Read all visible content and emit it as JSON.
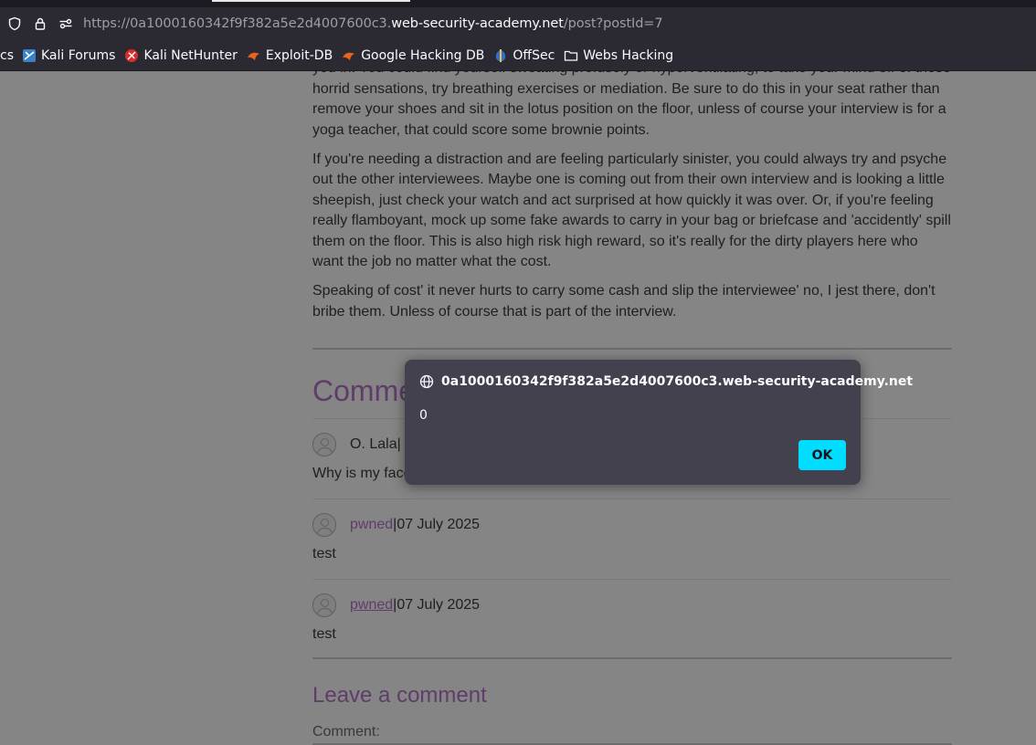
{
  "browser": {
    "url_prefix": "https://0a1000160342f9f382a5e2d4007600c3.",
    "url_domain": "web-security-academy.net",
    "url_path": "/post?postId=7",
    "bookmarks": [
      {
        "label": "cs",
        "icon": "none"
      },
      {
        "label": "Kali Forums",
        "icon": "kali-forums-icon"
      },
      {
        "label": "Kali NetHunter",
        "icon": "kali-nethunter-icon"
      },
      {
        "label": "Exploit-DB",
        "icon": "exploit-db-icon"
      },
      {
        "label": "Google Hacking DB",
        "icon": "ghdb-icon"
      },
      {
        "label": "OffSec",
        "icon": "offsec-icon"
      },
      {
        "label": "Webs Hacking",
        "icon": "folder-icon"
      }
    ]
  },
  "article": {
    "paragraphs": [
      "you in. You could find yourself sweating profusely or hyperventilating, to take your mind off of these horrid sensations, try breathing exercises or mediation. Be sure to do this in your seat rather than remove your shoes and sit in the lotus position on the floor, unless of course your interview is for a yoga teacher, that could score some brownie points.",
      "If you're needing a distraction and are feeling particularly sinister, you could always try and psyche out the other interviewees. Maybe one is coming out from their own interview and is looking a little sheepish, just check your watch and act surprised at how quickly it was over. Or, if you're feeling really flamboyant, mock up some fake awards to carry in your bag or briefcase and 'accidently' spill them on the floor. This is also high risk high reward, so it's really for the dirty players here who want the job no matter what the cost.",
      "Speaking of cost' it never hurts to carry some cash and slip the interviewee' no, I jest there, don't bribe them. Unless of course that is part of the interview."
    ]
  },
  "comments": {
    "title": "Comments",
    "items": [
      {
        "author": "O. Lala",
        "separator": " | ",
        "date": "",
        "text": "Why is my face",
        "linked": false
      },
      {
        "author": "pwned",
        "separator": " | ",
        "date": "07 July 2025",
        "text": "test",
        "linked": true
      },
      {
        "author": "pwned",
        "separator": " | ",
        "date": "07 July 2025",
        "text": "test",
        "linked": true
      }
    ]
  },
  "leave_comment": {
    "title": "Leave a comment",
    "comment_label": "Comment:"
  },
  "dialog": {
    "origin": "0a1000160342f9f382a5e2d4007600c3.web-security-academy.net",
    "message": "0",
    "ok_label": "OK"
  },
  "colors": {
    "accent": "#b36fc2",
    "dialog_bg": "#42414d",
    "ok_button": "#00ddff",
    "chrome_bg": "#2b2a33"
  }
}
